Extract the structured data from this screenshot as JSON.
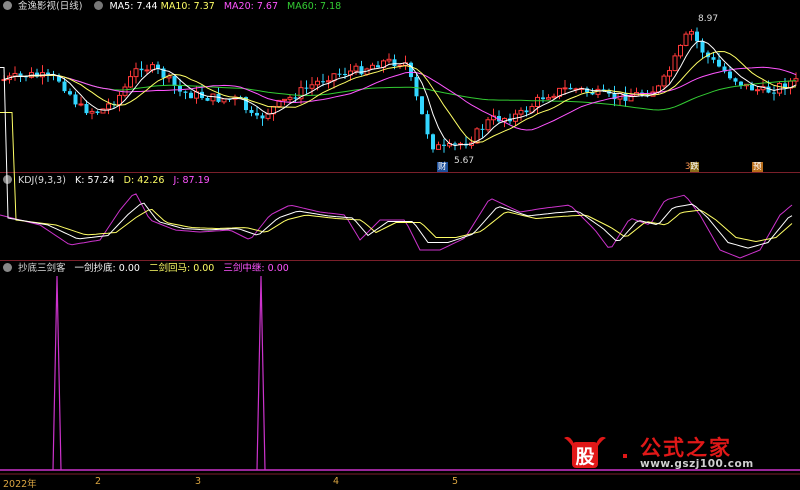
{
  "main": {
    "title": "金逸影视(日线)",
    "ma5_label": "MA5:",
    "ma5_value": "7.44",
    "ma10_label": "MA10:",
    "ma10_value": "7.37",
    "ma20_label": "MA20:",
    "ma20_value": "7.67",
    "ma60_label": "MA60:",
    "ma60_value": "7.18",
    "high_label": "8.97",
    "low_label": "5.67",
    "badge_cai": "财",
    "badge_die": "跌",
    "badge_die_prefix": "3",
    "badge_yu": "预"
  },
  "kdj": {
    "title": "KDJ(9,3,3)",
    "k_label": "K:",
    "k_value": "57.24",
    "d_label": "D:",
    "d_value": "42.26",
    "j_label": "J:",
    "j_value": "87.19"
  },
  "indicator": {
    "title": "抄底三剑客",
    "s1_label": "一剑抄底:",
    "s1_value": "0.00",
    "s2_label": "二剑回马:",
    "s2_value": "0.00",
    "s3_label": "三剑中继:",
    "s3_value": "0.00"
  },
  "xaxis": {
    "labels": [
      "2022年",
      "2",
      "3",
      "4",
      "5"
    ]
  },
  "watermark": {
    "logo_text": "股",
    "big_text": "公式之家",
    "url": "www.gszj100.com"
  },
  "colors": {
    "up": "#ff3a3a",
    "down": "#33d6ff",
    "ma5": "#ffffff",
    "ma10": "#ffff66",
    "ma20": "#ff55ff",
    "ma60": "#33cc33",
    "signal": "#cc33cc"
  }
}
